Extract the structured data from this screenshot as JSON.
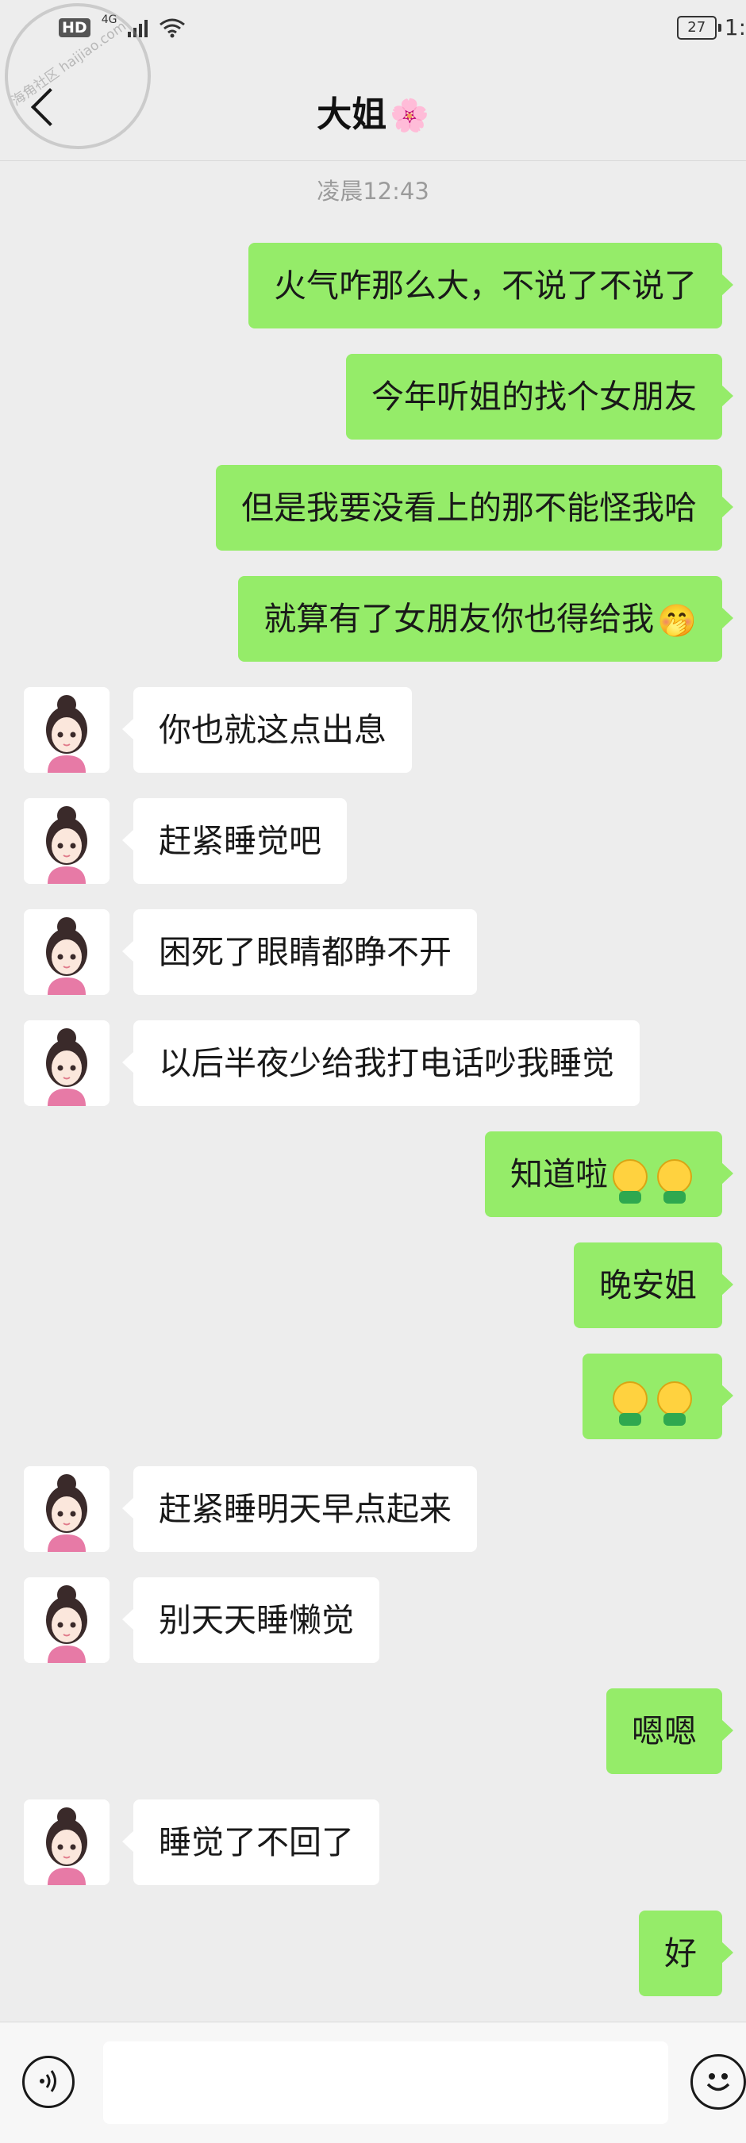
{
  "status_bar": {
    "hd": "HD",
    "network": "4G",
    "battery": "27",
    "time": "1:"
  },
  "watermark": {
    "text": "海角社区 haijiao.com"
  },
  "header": {
    "title": "大姐",
    "title_emoji": "🌸"
  },
  "timestamp": "凌晨12:43",
  "messages": [
    {
      "side": "right",
      "text": "火气咋那么大，不说了不说了"
    },
    {
      "side": "right",
      "text": "今年听姐的找个女朋友"
    },
    {
      "side": "right",
      "text": "但是我要没看上的那不能怪我哈"
    },
    {
      "side": "right",
      "text": "就算有了女朋友你也得给我",
      "emoji": "🤭"
    },
    {
      "side": "left",
      "text": "你也就这点出息"
    },
    {
      "side": "left",
      "text": "赶紧睡觉吧"
    },
    {
      "side": "left",
      "text": "困死了眼睛都睁不开"
    },
    {
      "side": "left",
      "text": "以后半夜少给我打电话吵我睡觉"
    },
    {
      "side": "right",
      "text": "知道啦",
      "emoji": "smile-hug-emoji x2"
    },
    {
      "side": "right",
      "text": "晚安姐"
    },
    {
      "side": "right",
      "text": "",
      "emoji": "smile-hug-emoji x2"
    },
    {
      "side": "left",
      "text": "赶紧睡明天早点起来"
    },
    {
      "side": "left",
      "text": "别天天睡懒觉"
    },
    {
      "side": "right",
      "text": "嗯嗯"
    },
    {
      "side": "left",
      "text": "睡觉了不回了"
    },
    {
      "side": "right",
      "text": "好"
    }
  ],
  "input_bar": {
    "placeholder": ""
  }
}
